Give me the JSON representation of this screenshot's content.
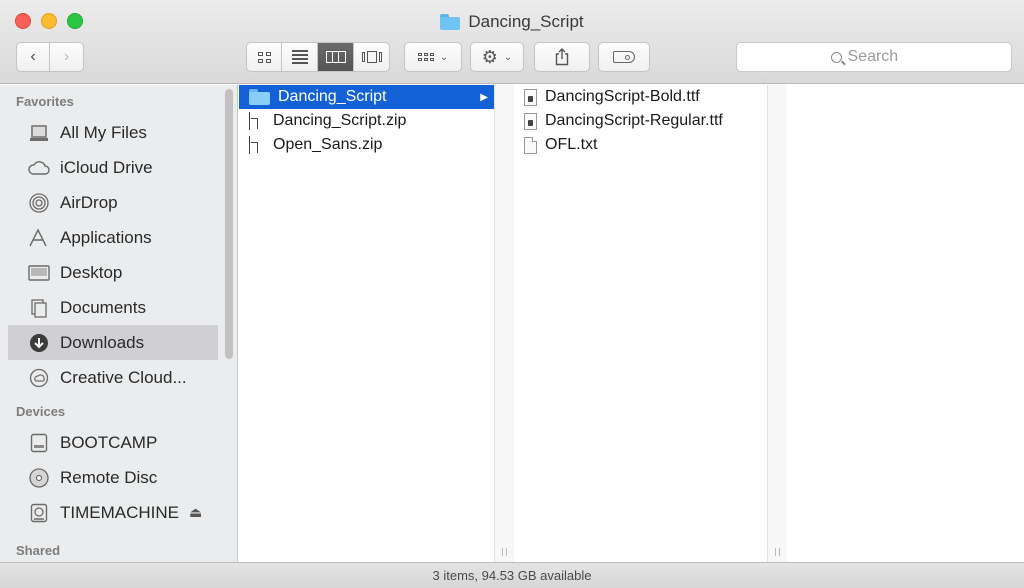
{
  "window": {
    "title": "Dancing_Script"
  },
  "toolbar": {
    "search_placeholder": "Search"
  },
  "sidebar": {
    "sections": [
      {
        "header": "Favorites",
        "items": [
          {
            "label": "All My Files",
            "icon": "all-files-icon"
          },
          {
            "label": "iCloud Drive",
            "icon": "cloud-icon"
          },
          {
            "label": "AirDrop",
            "icon": "airdrop-icon"
          },
          {
            "label": "Applications",
            "icon": "applications-icon"
          },
          {
            "label": "Desktop",
            "icon": "desktop-icon"
          },
          {
            "label": "Documents",
            "icon": "documents-icon"
          },
          {
            "label": "Downloads",
            "icon": "downloads-icon",
            "selected": true
          },
          {
            "label": "Creative Cloud...",
            "icon": "creative-cloud-icon"
          }
        ]
      },
      {
        "header": "Devices",
        "items": [
          {
            "label": "BOOTCAMP",
            "icon": "disk-icon"
          },
          {
            "label": "Remote Disc",
            "icon": "disc-icon"
          },
          {
            "label": "TIMEMACHINE",
            "icon": "timemachine-icon",
            "eject": "⏏"
          }
        ]
      },
      {
        "header": "Shared",
        "items": []
      }
    ]
  },
  "columns": {
    "col1": [
      {
        "name": "Dancing_Script",
        "type": "folder",
        "selected": true
      },
      {
        "name": "Dancing_Script.zip",
        "type": "zip"
      },
      {
        "name": "Open_Sans.zip",
        "type": "zip"
      }
    ],
    "col2": [
      {
        "name": "DancingScript-Bold.ttf",
        "type": "font"
      },
      {
        "name": "DancingScript-Regular.ttf",
        "type": "font"
      },
      {
        "name": "OFL.txt",
        "type": "doc"
      }
    ]
  },
  "status": {
    "text": "3 items, 94.53 GB available"
  },
  "colors": {
    "selection": "#1361d7",
    "sidebar_bg": "#ebeced"
  }
}
